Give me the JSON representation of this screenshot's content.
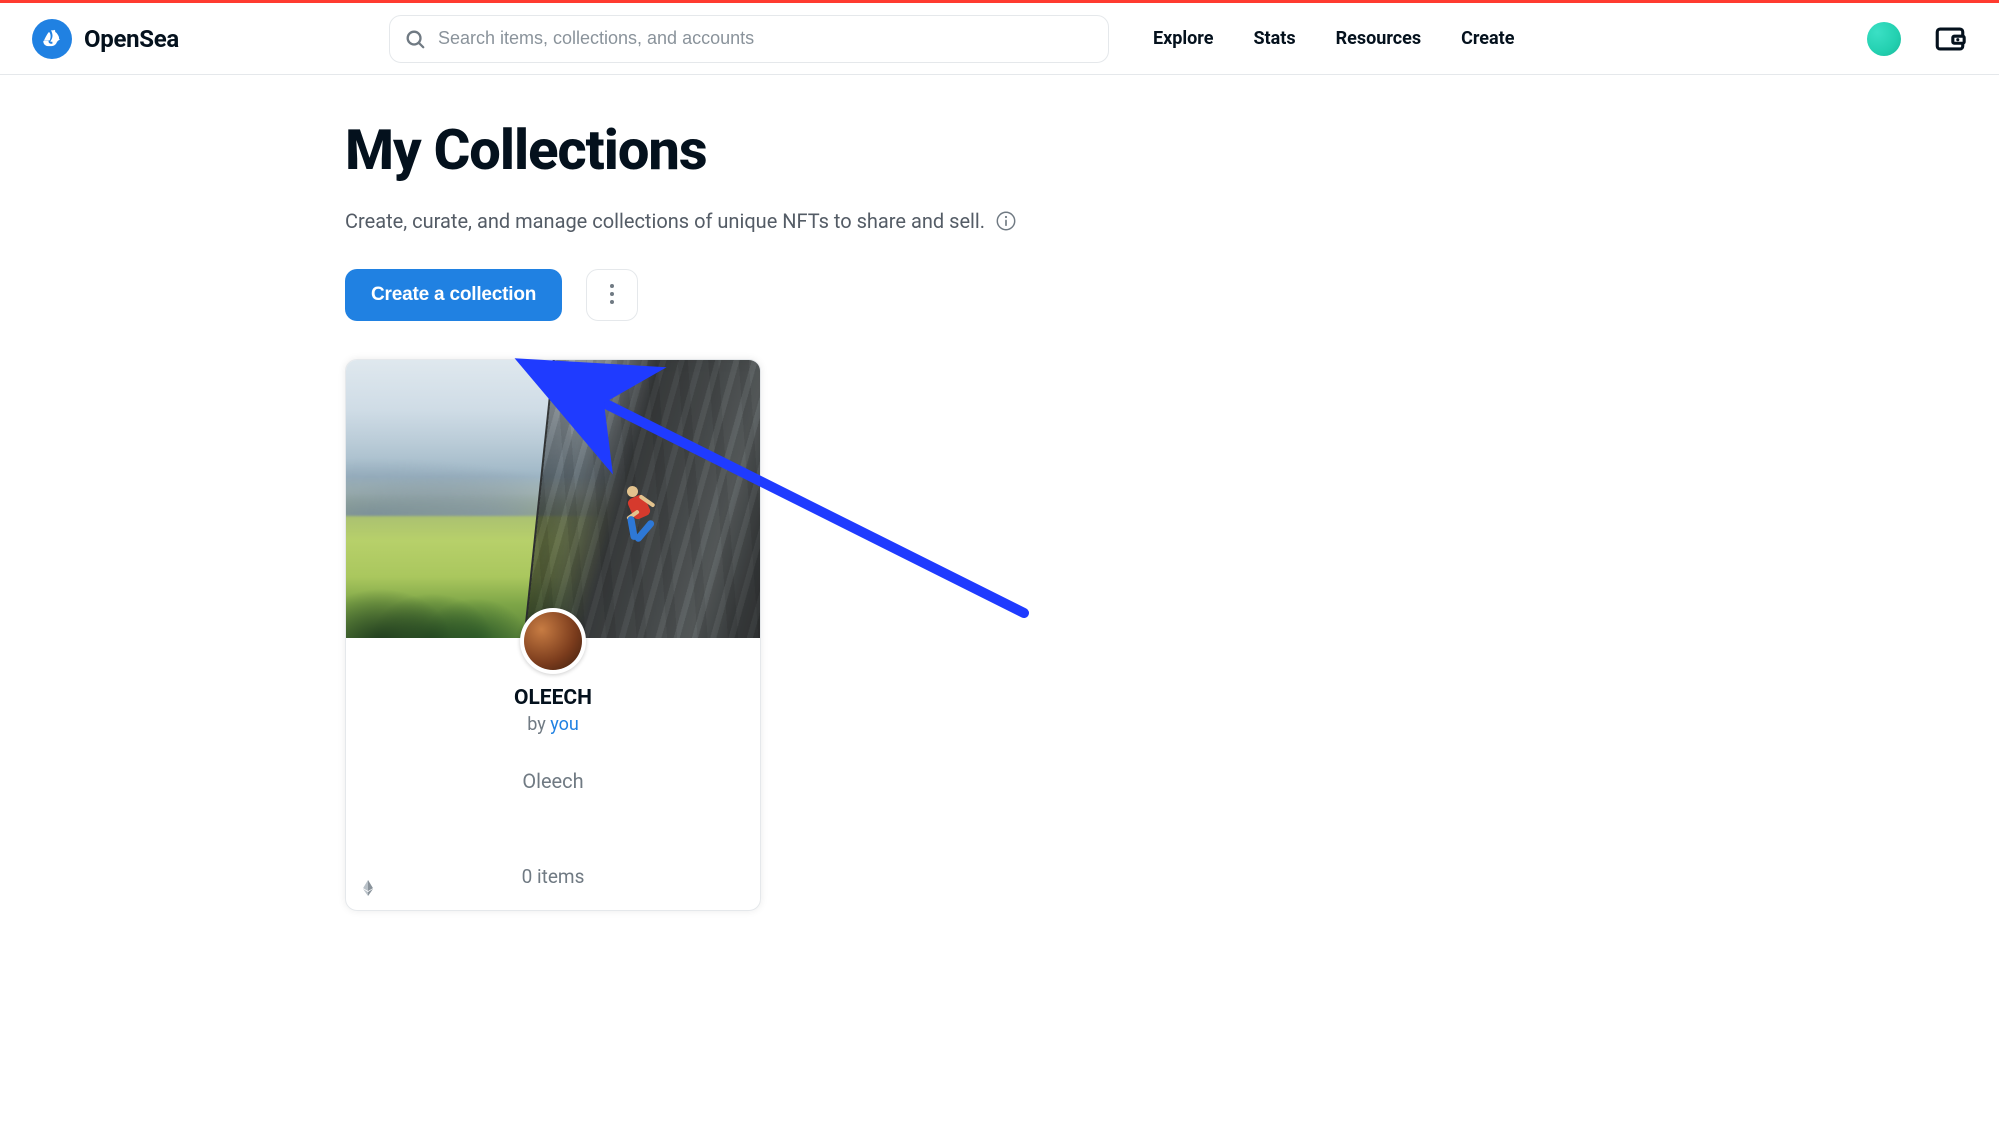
{
  "brand": {
    "name": "OpenSea"
  },
  "search": {
    "placeholder": "Search items, collections, and accounts"
  },
  "nav": {
    "explore": "Explore",
    "stats": "Stats",
    "resources": "Resources",
    "create": "Create"
  },
  "page": {
    "title": "My Collections",
    "sub": "Create, curate, and manage collections of unique NFTs to share and sell."
  },
  "actions": {
    "create_collection": "Create a collection"
  },
  "collection": {
    "name": "OLEECH",
    "by_prefix": "by ",
    "by_who": "you",
    "description": "Oleech",
    "items_count": "0 items",
    "chain": "ethereum"
  },
  "annotation": {
    "meaning": "arrow pointing at the Create a collection button"
  },
  "colors": {
    "primary": "#2081e2",
    "text": "#04111d",
    "muted": "#707a83",
    "border": "#e5e8eb",
    "arrow": "#1f3bff"
  }
}
